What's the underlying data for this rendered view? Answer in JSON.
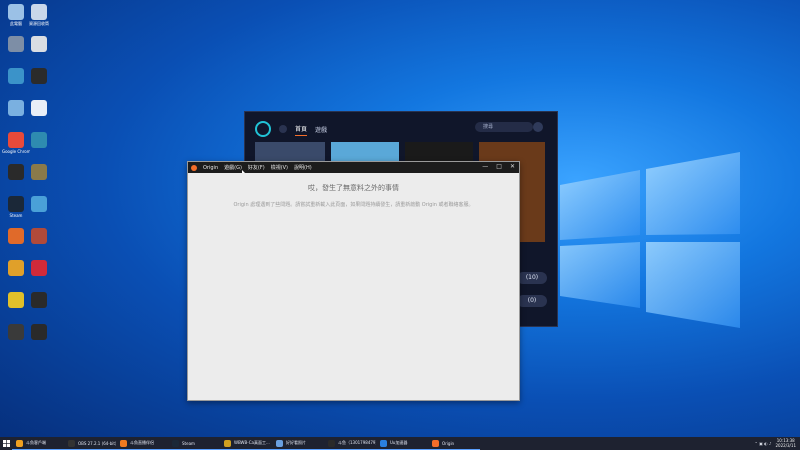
{
  "desktop": {
    "icons": [
      {
        "label": "此電腦",
        "color": "#9bc1e6"
      },
      {
        "label": "資源回收筒",
        "color": "#c9d7ea"
      },
      {
        "label": "",
        "color": "#7d8ea6"
      },
      {
        "label": "",
        "color": "#d9dde3"
      },
      {
        "label": "",
        "color": "#3b93c9"
      },
      {
        "label": "",
        "color": "#2b2b2b"
      },
      {
        "label": "",
        "color": "#7ab0e0"
      },
      {
        "label": "",
        "color": "#e8eef7"
      },
      {
        "label": "Google Chrome",
        "color": "#e84a3a"
      },
      {
        "label": "",
        "color": "#2e8bb0"
      },
      {
        "label": "",
        "color": "#2a2a2a"
      },
      {
        "label": "",
        "color": "#8a7a4a"
      },
      {
        "label": "Steam",
        "color": "#1b2838"
      },
      {
        "label": "",
        "color": "#4aa0d8"
      },
      {
        "label": "",
        "color": "#e06a2a"
      },
      {
        "label": "",
        "color": "#b04a3a"
      },
      {
        "label": "",
        "color": "#e0a02a"
      },
      {
        "label": "",
        "color": "#d02a3a"
      },
      {
        "label": "",
        "color": "#e0c02a"
      },
      {
        "label": "",
        "color": "#2a2a2a"
      },
      {
        "label": "",
        "color": "#3a3a3a"
      },
      {
        "label": "",
        "color": "#2a2a2a"
      }
    ]
  },
  "launcher": {
    "nav": [
      "首頁",
      "遊戲"
    ],
    "search_placeholder": "搜尋",
    "side_counts": [
      "(10)",
      "(0)"
    ],
    "tile_colors": [
      "#3a4a6a",
      "#5aa8d8",
      "#1a1a1a",
      "#6a3a1a"
    ]
  },
  "error_window": {
    "menu": [
      "Origin",
      "遊戲(G)",
      "好友(F)",
      "檢視(V)",
      "說明(H)"
    ],
    "controls": [
      "—",
      "□",
      "✕"
    ],
    "heading": "哎，發生了無意料之外的事情",
    "message": "Origin 處理遇到了些問題。請嘗試重新載入此頁面，如果問題持續發生，請重新啟動 Origin 或者聯絡客服。"
  },
  "taskbar": {
    "start_icon": "windows-icon",
    "items": [
      {
        "label": "斗魚客戶端",
        "color": "#f0a020"
      },
      {
        "label": "OBS 27.2.1 (64-bit)",
        "color": "#333333"
      },
      {
        "label": "斗魚直播伴侶",
        "color": "#f07a20"
      },
      {
        "label": "Steam",
        "color": "#1b2838"
      },
      {
        "label": "WBWB-Ca真面工...",
        "color": "#d0a020"
      },
      {
        "label": "好好看照片",
        "color": "#6aa0e0"
      },
      {
        "label": "斗鱼（1301798479）",
        "color": "#2a2a2a"
      },
      {
        "label": "Uu加速器",
        "color": "#2a80e0"
      },
      {
        "label": "Origin",
        "color": "#f36d2a"
      }
    ],
    "time": "10:13:38",
    "date": "2022/3/11"
  }
}
